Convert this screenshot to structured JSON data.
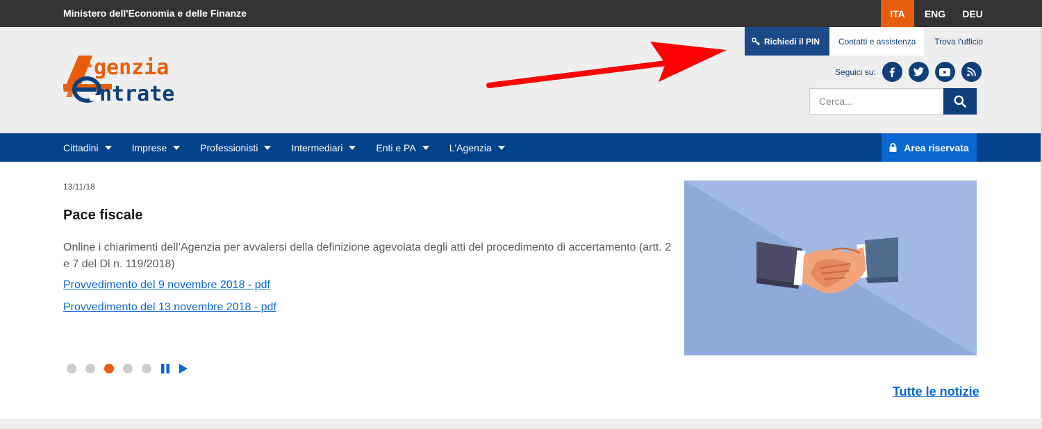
{
  "topbar": {
    "ministry": "Ministero dell'Economia e delle Finanze",
    "languages": [
      {
        "label": "ITA",
        "active": true
      },
      {
        "label": "ENG",
        "active": false
      },
      {
        "label": "DEU",
        "active": false
      }
    ]
  },
  "header": {
    "logo": {
      "line1": "genzia",
      "line2": "ntrate"
    },
    "utility_links": [
      "Richiedi il PIN",
      "Contatti e assistenza",
      "Trova l'ufficio"
    ],
    "social_label": "Seguici su:",
    "social_icons": [
      "facebook-icon",
      "twitter-icon",
      "youtube-icon",
      "rss-icon"
    ],
    "search_placeholder": "Cerca..."
  },
  "nav": {
    "items": [
      "Cittadini",
      "Imprese",
      "Professionisti",
      "Intermediari",
      "Enti e PA",
      "L'Agenzia"
    ],
    "reserved": "Area riservata"
  },
  "news": {
    "date": "13/11/18",
    "title": "Pace fiscale",
    "description": "Online i chiarimenti dell’Agenzia per avvalersi della definizione agevolata degli atti del procedimento di accertamento (artt. 2 e 7 del Dl n. 119/2018)",
    "links": [
      "Provvedimento del 9 novembre 2018 - pdf",
      "Provvedimento del 13 novembre 2018 - pdf"
    ],
    "carousel": {
      "slides": 5,
      "active_index": 2
    },
    "all_news": "Tutte le notizie"
  },
  "colors": {
    "topbar": "#333333",
    "accent_orange": "#e85c0d",
    "primary_blue": "#04438b",
    "link_blue": "#0a66d0",
    "annotation_arrow": "#ff0000"
  }
}
